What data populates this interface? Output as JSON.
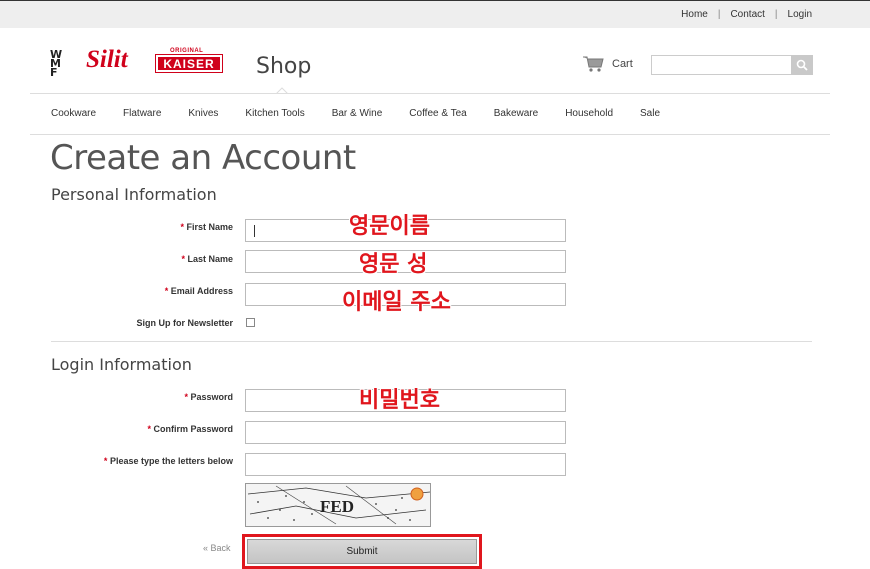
{
  "toplinks": {
    "home": "Home",
    "contact": "Contact",
    "login": "Login",
    "sep": "|"
  },
  "logos": {
    "wmf": "WMF",
    "silit": "Silit",
    "kaiser_original": "ORIGINAL",
    "kaiser": "KAISER"
  },
  "header": {
    "shop_tab": "Shop",
    "cart_label": "Cart",
    "search_value": ""
  },
  "nav": [
    "Cookware",
    "Flatware",
    "Knives",
    "Kitchen Tools",
    "Bar & Wine",
    "Coffee & Tea",
    "Bakeware",
    "Household",
    "Sale"
  ],
  "page_title": "Create an Account",
  "personal": {
    "heading": "Personal Information",
    "first_name": {
      "label": "First Name",
      "overlay": "영문이름"
    },
    "last_name": {
      "label": "Last Name",
      "overlay": "영문 성"
    },
    "email": {
      "label": "Email Address",
      "overlay": "이메일 주소"
    },
    "newsletter": {
      "label": "Sign Up for Newsletter",
      "checked": false
    }
  },
  "login": {
    "heading": "Login Information",
    "password": {
      "label": "Password",
      "overlay": "비밀번호"
    },
    "confirm": {
      "label": "Confirm Password"
    },
    "captcha": {
      "label": "Please type the letters below",
      "image_text": "FED"
    }
  },
  "required_mark": "*",
  "actions": {
    "back": "« Back",
    "submit": "Submit"
  },
  "colors": {
    "accent_red": "#e0161d",
    "brand_red": "#d0011b",
    "topbar": "#eeeeee"
  }
}
